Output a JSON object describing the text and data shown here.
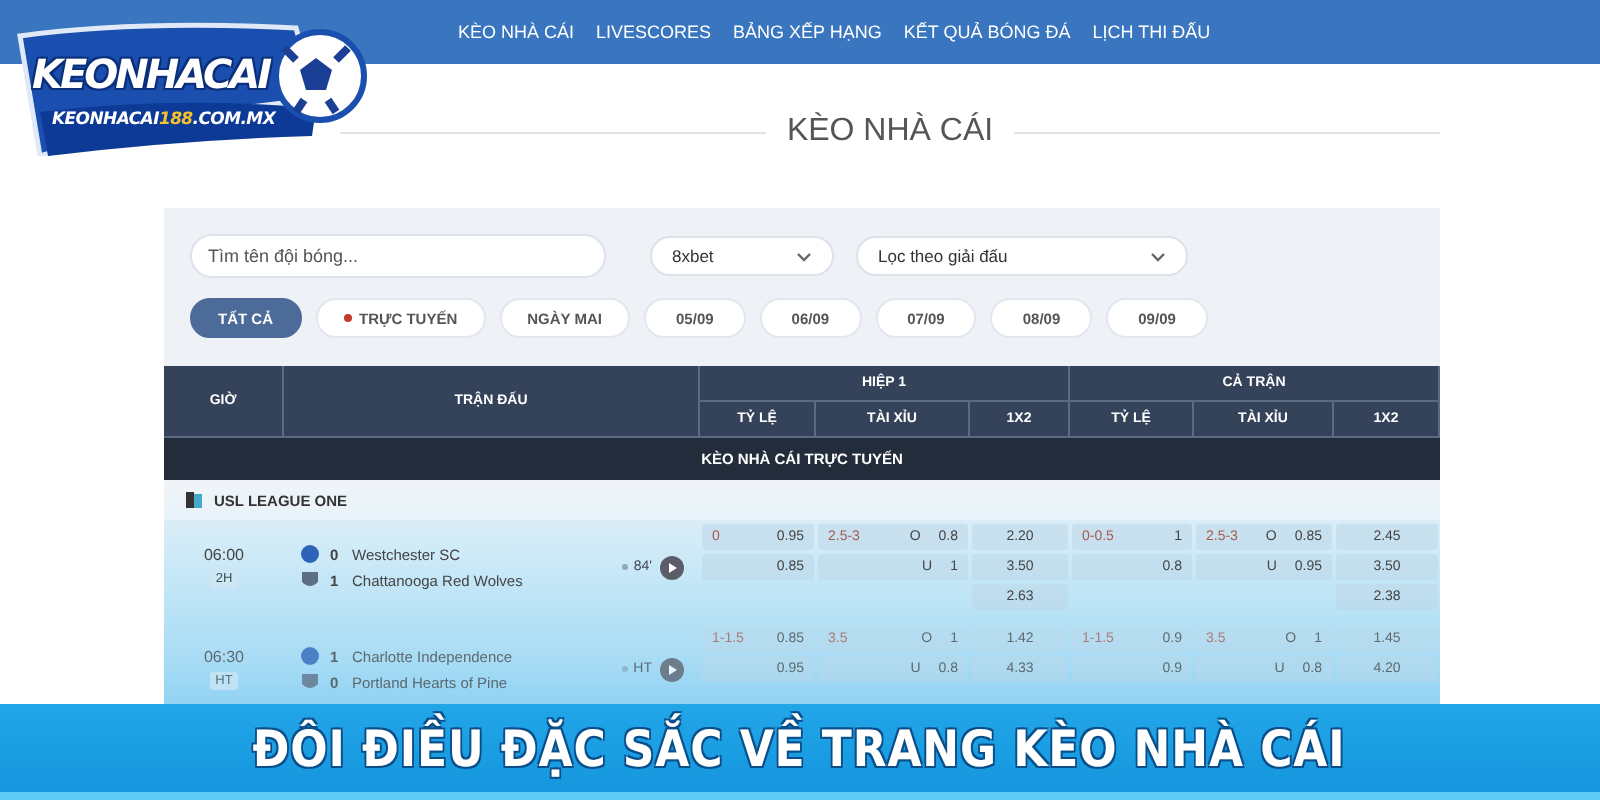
{
  "nav": {
    "items": [
      "KÈO NHÀ CÁI",
      "LIVESCORES",
      "BẢNG XẾP HẠNG",
      "KẾT QUẢ BÓNG ĐÁ",
      "LỊCH THI ĐẤU"
    ]
  },
  "logo": {
    "title": "KEONHACAI",
    "domain_name": "KEONHACAI",
    "domain_number": "188",
    "domain_suffix": ".COM.MX"
  },
  "heading": "KÈO NHÀ CÁI",
  "filters": {
    "search": {
      "placeholder": "Tìm tên đội bóng..."
    },
    "bookmaker": {
      "value": "8xbet"
    },
    "league": {
      "value": "Lọc theo giải đấu"
    },
    "chips": [
      {
        "label": "TẤT CẢ",
        "selected": true,
        "live": false
      },
      {
        "label": "TRỰC TUYẾN",
        "selected": false,
        "live": true
      },
      {
        "label": "NGÀY MAI",
        "selected": false,
        "live": false
      },
      {
        "label": "05/09",
        "selected": false,
        "live": false
      },
      {
        "label": "06/09",
        "selected": false,
        "live": false
      },
      {
        "label": "07/09",
        "selected": false,
        "live": false
      },
      {
        "label": "08/09",
        "selected": false,
        "live": false
      },
      {
        "label": "09/09",
        "selected": false,
        "live": false
      }
    ]
  },
  "table": {
    "time_header": "GIỜ",
    "match_header": "TRẬN ĐẤU",
    "groups": [
      {
        "label": "HIỆP 1",
        "subheaders": [
          "TỶ LỆ",
          "TÀI XỈU",
          "1X2"
        ]
      },
      {
        "label": "CẢ TRẬN",
        "subheaders": [
          "TỶ LỆ",
          "TÀI XỈU",
          "1X2"
        ]
      }
    ],
    "section": "KÈO NHÀ CÁI TRỰC TUYẾN",
    "league": "USL LEAGUE ONE",
    "matches": [
      {
        "time": "06:00",
        "period": "2H",
        "minute": "84'",
        "teams": [
          {
            "score": "0",
            "name": "Westchester SC"
          },
          {
            "score": "1",
            "name": "Chattanooga Red Wolves"
          }
        ],
        "odds": [
          {
            "handicap_line": "0",
            "handicap": [
              "0.95",
              "0.85"
            ],
            "total_line": "2.5-3",
            "totals": [
              {
                "side": "O",
                "value": "0.8"
              },
              {
                "side": "U",
                "value": "1"
              }
            ],
            "result": [
              "2.20",
              "3.50",
              "2.63"
            ]
          },
          {
            "handicap_line": "0-0.5",
            "handicap": [
              "1",
              "0.8"
            ],
            "total_line": "2.5-3",
            "totals": [
              {
                "side": "O",
                "value": "0.85"
              },
              {
                "side": "U",
                "value": "0.95"
              }
            ],
            "result": [
              "2.45",
              "3.50",
              "2.38"
            ]
          }
        ]
      },
      {
        "time": "06:30",
        "period": "HT",
        "minute": "HT",
        "teams": [
          {
            "score": "1",
            "name": "Charlotte Independence"
          },
          {
            "score": "0",
            "name": "Portland Hearts of Pine"
          }
        ],
        "odds": [
          {
            "handicap_line": "1-1.5",
            "handicap": [
              "0.85",
              "0.95"
            ],
            "total_line": "3.5",
            "totals": [
              {
                "side": "O",
                "value": "1"
              },
              {
                "side": "U",
                "value": "0.8"
              }
            ],
            "result": [
              "1.42",
              "4.33"
            ]
          },
          {
            "handicap_line": "1-1.5",
            "handicap": [
              "0.9",
              "0.9"
            ],
            "total_line": "3.5",
            "totals": [
              {
                "side": "O",
                "value": "1"
              },
              {
                "side": "U",
                "value": "0.8"
              }
            ],
            "result": [
              "1.45",
              "4.20"
            ]
          }
        ]
      }
    ]
  },
  "banner": "ĐÔI ĐIỀU ĐẶC SẮC VỀ TRANG KÈO NHÀ CÁI"
}
